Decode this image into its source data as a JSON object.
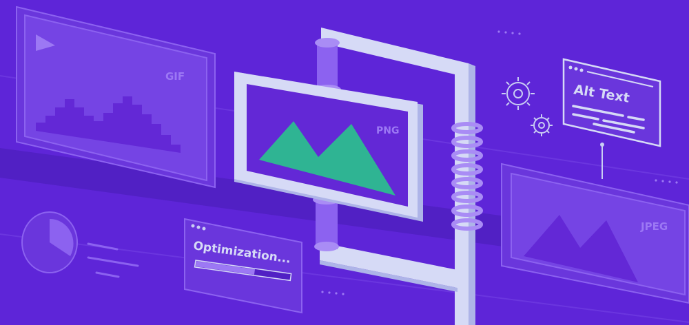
{
  "frames": {
    "gif_label": "GIF",
    "png_label": "PNG",
    "jpeg_label": "JPEG"
  },
  "alt_text_card": {
    "title": "Alt Text"
  },
  "optimization_card": {
    "title": "Optimization...",
    "progress": 0.62
  },
  "pie_chart": {
    "filled_fraction": 0.3
  },
  "colors": {
    "background": "#5e25d8",
    "panel_outline": "#7f55e6",
    "clamp": "#d6daf6",
    "clamp_shade": "#aeb4e8",
    "mountain_green": "#2fb493",
    "accent_violet": "#8c62f0"
  },
  "icons": [
    "play-icon",
    "gear-icon",
    "pie-chart-icon",
    "mountain-image-icon"
  ]
}
